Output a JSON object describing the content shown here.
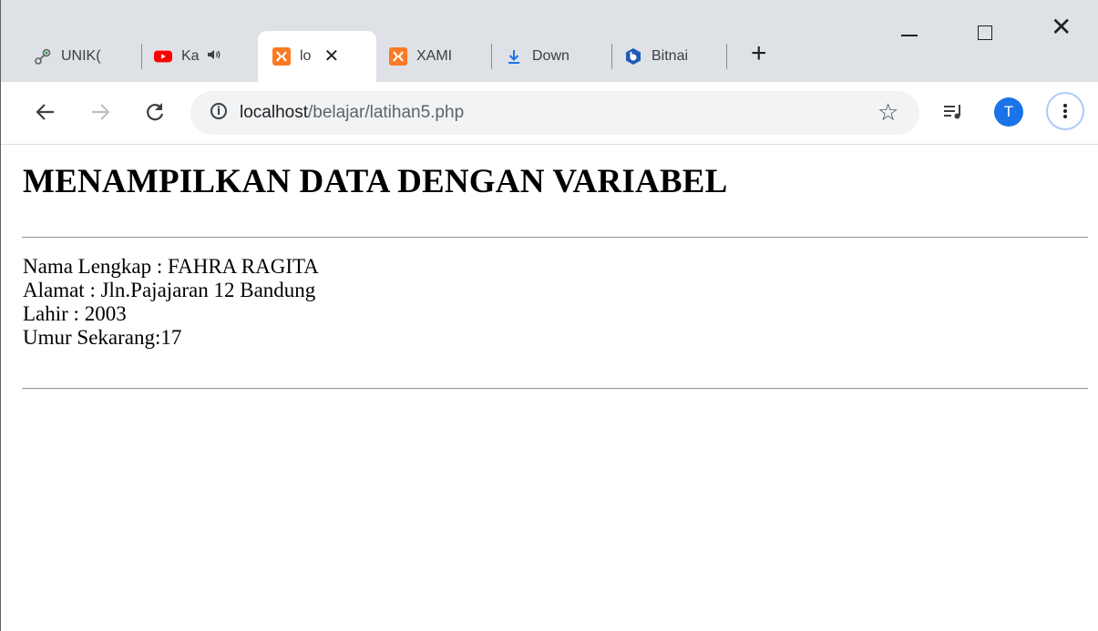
{
  "tabs": [
    {
      "label": "UNIK(",
      "icon": "link-icon"
    },
    {
      "label": "Ka",
      "icon": "youtube-icon"
    },
    {
      "label": "lo",
      "icon": "xampp-icon",
      "active": true
    },
    {
      "label": "XAMI",
      "icon": "xampp-icon"
    },
    {
      "label": "Down",
      "icon": "download-icon"
    },
    {
      "label": "Bitnai",
      "icon": "bitnami-icon"
    }
  ],
  "toolbar": {
    "url_host": "localhost",
    "url_path": "/belajar/latihan5.php",
    "avatar_letter": "T"
  },
  "page": {
    "heading": "MENAMPILKAN DATA DENGAN VARIABEL",
    "lines": [
      "Nama Lengkap : FAHRA RAGITA",
      "Alamat : Jln.Pajajaran 12 Bandung",
      "Lahir : 2003",
      "Umur Sekarang:17"
    ]
  },
  "colors": {
    "tabstrip": "#dee1e6",
    "youtube": "#ff0000",
    "xampp": "#fb7a24",
    "download": "#1a73e8",
    "bitnami": "#1e5bb8",
    "avatar": "#1a73e8"
  }
}
